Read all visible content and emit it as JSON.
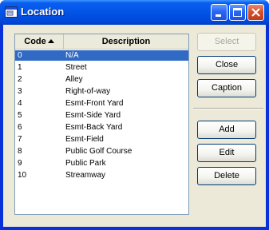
{
  "window": {
    "title": "Location",
    "icon": "window-app-icon",
    "controls": [
      "minimize-icon",
      "maximize-icon",
      "close-icon"
    ]
  },
  "list": {
    "columns": [
      {
        "label": "Code",
        "sorted": "ascending"
      },
      {
        "label": "Description"
      }
    ],
    "rows": [
      {
        "code": "0",
        "description": "N/A",
        "selected": true
      },
      {
        "code": "1",
        "description": "Street"
      },
      {
        "code": "2",
        "description": "Alley"
      },
      {
        "code": "3",
        "description": "Right-of-way"
      },
      {
        "code": "4",
        "description": "Esmt-Front Yard"
      },
      {
        "code": "5",
        "description": "Esmt-Side Yard"
      },
      {
        "code": "6",
        "description": "Esmt-Back Yard"
      },
      {
        "code": "7",
        "description": "Esmt-Field"
      },
      {
        "code": "8",
        "description": "Public Golf Course"
      },
      {
        "code": "9",
        "description": "Public Park"
      },
      {
        "code": "10",
        "description": "Streamway"
      }
    ]
  },
  "buttons": {
    "select": "Select",
    "close": "Close",
    "caption": "Caption",
    "add": "Add",
    "edit": "Edit",
    "delete": "Delete"
  },
  "colors": {
    "titlebar": "#0254e6",
    "selection": "#316ac5",
    "dialog_face": "#ece9d8"
  }
}
